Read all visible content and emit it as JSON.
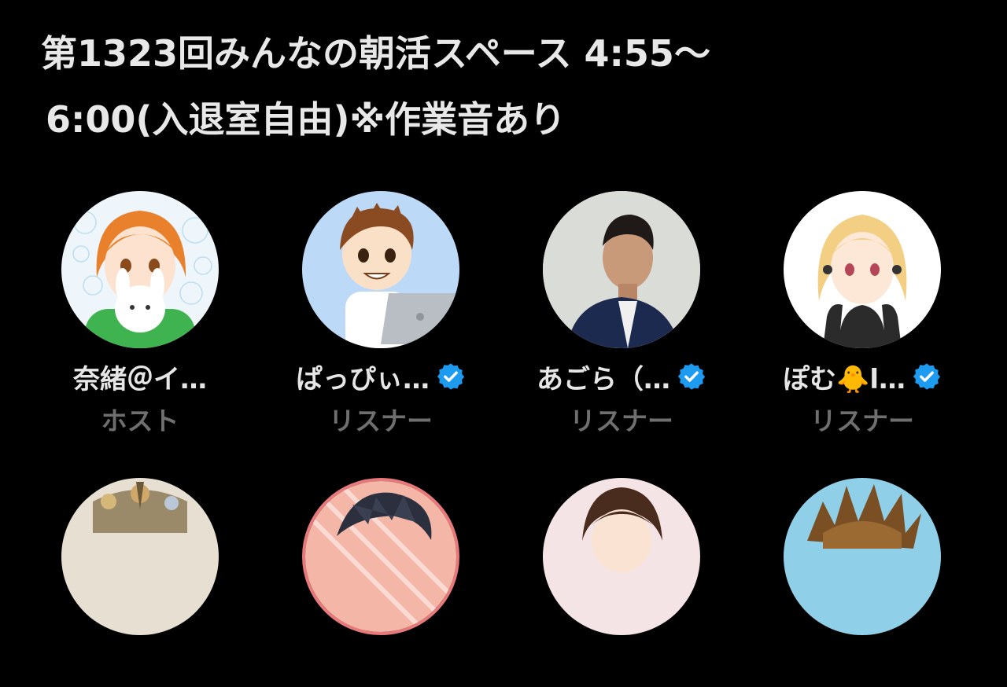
{
  "space": {
    "title_line1": "第1323回みんなの朝活スペース 4:55〜",
    "title_line2": "6:00(入退室自由)※作業音あり"
  },
  "participants": [
    {
      "name": "奈緒＠イ…",
      "role": "ホスト",
      "verified": false,
      "avatar_icon": "avatar-orange-hair-girl"
    },
    {
      "name": "ぱっぴぃ…",
      "role": "リスナー",
      "verified": true,
      "avatar_icon": "avatar-boy-laptop"
    },
    {
      "name": "あごら（…",
      "role": "リスナー",
      "verified": true,
      "avatar_icon": "avatar-man-photo"
    },
    {
      "name": "ぽむ🐥l…",
      "role": "リスナー",
      "verified": true,
      "avatar_icon": "avatar-blonde-girl"
    },
    {
      "name": "",
      "role": "",
      "verified": false,
      "avatar_icon": "avatar-floral"
    },
    {
      "name": "",
      "role": "",
      "verified": false,
      "avatar_icon": "avatar-dark-hair-boy"
    },
    {
      "name": "",
      "role": "",
      "verified": false,
      "avatar_icon": "avatar-girl-brown-hair"
    },
    {
      "name": "",
      "role": "",
      "verified": false,
      "avatar_icon": "avatar-spiky-hair"
    }
  ],
  "colors": {
    "background": "#000000",
    "name_text": "#e6e6e6",
    "role_text": "#6f6f6f",
    "verified_badge": "#1d9bf0"
  }
}
